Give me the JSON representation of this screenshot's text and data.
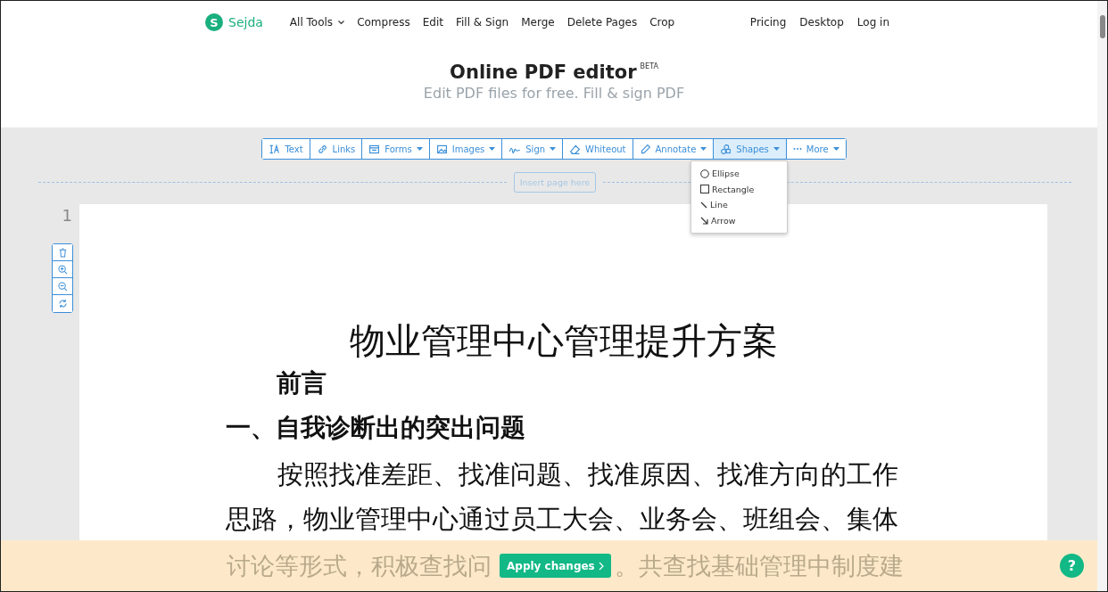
{
  "brand": {
    "logo_letter": "S",
    "name": "Sejda"
  },
  "nav": [
    {
      "label": "All Tools",
      "dropdown": true
    },
    {
      "label": "Compress",
      "dropdown": false
    },
    {
      "label": "Edit",
      "dropdown": false
    },
    {
      "label": "Fill & Sign",
      "dropdown": false
    },
    {
      "label": "Merge",
      "dropdown": false
    },
    {
      "label": "Delete Pages",
      "dropdown": false
    },
    {
      "label": "Crop",
      "dropdown": false
    }
  ],
  "nav_right": [
    "Pricing",
    "Desktop",
    "Log in"
  ],
  "hero": {
    "title": "Online PDF editor",
    "badge": "BETA",
    "subtitle": "Edit PDF files for free. Fill & sign PDF"
  },
  "toolbar": [
    {
      "kind": "text",
      "label": "Text",
      "dropdown": false,
      "selected": false
    },
    {
      "kind": "links",
      "label": "Links",
      "dropdown": false,
      "selected": false
    },
    {
      "kind": "forms",
      "label": "Forms",
      "dropdown": true,
      "selected": false
    },
    {
      "kind": "images",
      "label": "Images",
      "dropdown": true,
      "selected": false
    },
    {
      "kind": "sign",
      "label": "Sign",
      "dropdown": true,
      "selected": false
    },
    {
      "kind": "whiteout",
      "label": "Whiteout",
      "dropdown": false,
      "selected": false
    },
    {
      "kind": "annotate",
      "label": "Annotate",
      "dropdown": true,
      "selected": false
    },
    {
      "kind": "shapes",
      "label": "Shapes",
      "dropdown": true,
      "selected": true
    },
    {
      "kind": "more",
      "label": "More",
      "dropdown": true,
      "selected": false
    }
  ],
  "shapes_menu": [
    {
      "kind": "ellipse",
      "label": "Ellipse"
    },
    {
      "kind": "rectangle",
      "label": "Rectangle"
    },
    {
      "kind": "line",
      "label": "Line"
    },
    {
      "kind": "arrow",
      "label": "Arrow"
    }
  ],
  "insert_page": "Insert page here",
  "page_number": "1",
  "page_tools": [
    {
      "kind": "delete"
    },
    {
      "kind": "zoom-in"
    },
    {
      "kind": "zoom-out"
    },
    {
      "kind": "rotate"
    }
  ],
  "document": {
    "title": "物业管理中心管理提升方案",
    "preface": "前言",
    "heading": "一、自我诊断出的突出问题",
    "paragraph": "按照找准差距、找准问题、找准原因、找准方向的工作思路，物业管理中心通过员工大会、业务会、班组会、集体",
    "covered_text": [
      "讨论等形式，积极查找问",
      "。共查找基础管理中制度建"
    ]
  },
  "apply_button": "Apply changes",
  "help_button": "?"
}
